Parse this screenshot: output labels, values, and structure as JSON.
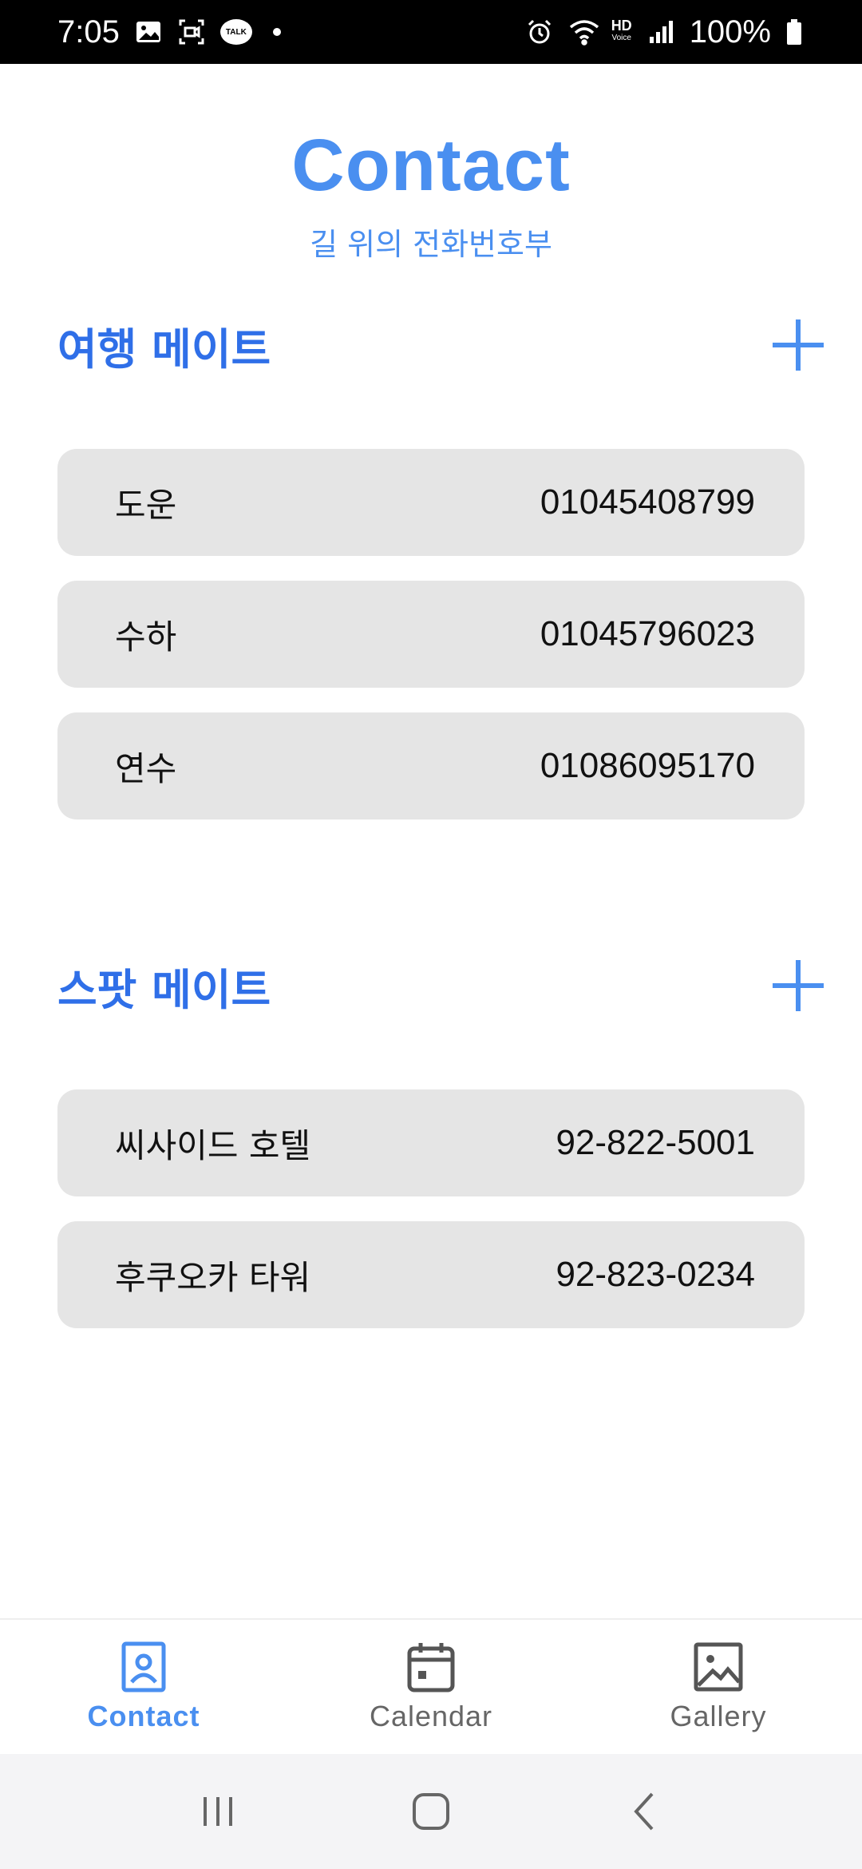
{
  "status_bar": {
    "time": "7:05",
    "talk_label": "TALK",
    "hd_label": "HD",
    "voice_label": "Voice",
    "battery": "100%"
  },
  "header": {
    "title": "Contact",
    "subtitle": "길 위의 전화번호부"
  },
  "sections": [
    {
      "title": "여행 메이트",
      "contacts": [
        {
          "name": "도운",
          "phone": "01045408799"
        },
        {
          "name": "수하",
          "phone": "01045796023"
        },
        {
          "name": "연수",
          "phone": "01086095170"
        }
      ]
    },
    {
      "title": "스팟 메이트",
      "contacts": [
        {
          "name": "씨사이드 호텔",
          "phone": "92-822-5001"
        },
        {
          "name": "후쿠오카 타워",
          "phone": "92-823-0234"
        }
      ]
    }
  ],
  "bottom_nav": {
    "items": [
      {
        "label": "Contact",
        "icon": "contact-icon",
        "active": true
      },
      {
        "label": "Calendar",
        "icon": "calendar-icon",
        "active": false
      },
      {
        "label": "Gallery",
        "icon": "gallery-icon",
        "active": false
      }
    ]
  },
  "colors": {
    "accent": "#4a8ff0",
    "section_title": "#2f6fe8",
    "card_bg": "#e5e5e5"
  }
}
